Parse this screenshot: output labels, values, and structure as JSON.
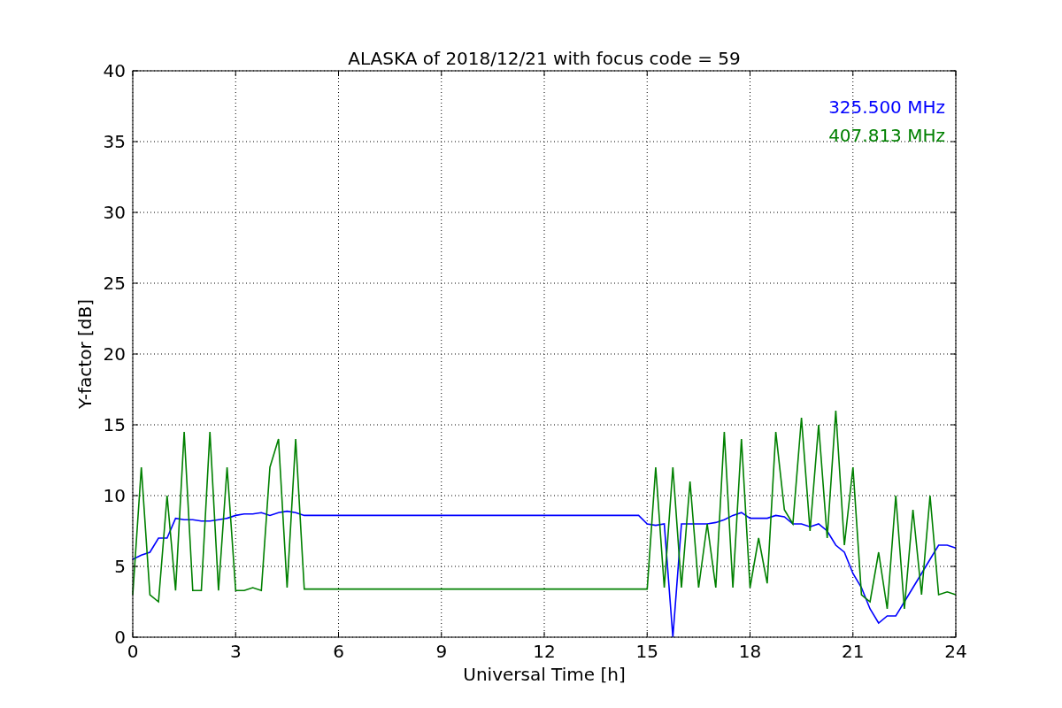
{
  "chart_data": {
    "type": "line",
    "title": "ALASKA of 2018/12/21 with focus code = 59",
    "xlabel": "Universal Time [h]",
    "ylabel": "Y-factor [dB]",
    "x": [
      0,
      0.25,
      0.5,
      0.75,
      1,
      1.25,
      1.5,
      1.75,
      2,
      2.25,
      2.5,
      2.75,
      3,
      3.25,
      3.5,
      3.75,
      4,
      4.25,
      4.5,
      4.75,
      5,
      5.25,
      5.5,
      5.75,
      6,
      6.25,
      6.5,
      6.75,
      7,
      7.25,
      7.5,
      7.75,
      8,
      8.25,
      8.5,
      8.75,
      9,
      9.25,
      9.5,
      9.75,
      10,
      10.25,
      10.5,
      10.75,
      11,
      11.25,
      11.5,
      11.75,
      12,
      12.25,
      12.5,
      12.75,
      13,
      13.25,
      13.5,
      13.75,
      14,
      14.25,
      14.5,
      14.75,
      15,
      15.25,
      15.5,
      15.75,
      16,
      16.25,
      16.5,
      16.75,
      17,
      17.25,
      17.5,
      17.75,
      18,
      18.25,
      18.5,
      18.75,
      19,
      19.25,
      19.5,
      19.75,
      20,
      20.25,
      20.5,
      20.75,
      21,
      21.25,
      21.5,
      21.75,
      22,
      22.25,
      22.5,
      22.75,
      23,
      23.25,
      23.5,
      23.75,
      24
    ],
    "series": [
      {
        "name": "325.500 MHz",
        "color": "#0000ff",
        "values": [
          5.5,
          5.8,
          6,
          7,
          7,
          8.4,
          8.3,
          8.3,
          8.2,
          8.2,
          8.3,
          8.4,
          8.6,
          8.7,
          8.7,
          8.8,
          8.6,
          8.8,
          8.9,
          8.8,
          8.6,
          8.6,
          8.6,
          8.6,
          8.6,
          8.6,
          8.6,
          8.6,
          8.6,
          8.6,
          8.6,
          8.6,
          8.6,
          8.6,
          8.6,
          8.6,
          8.6,
          8.6,
          8.6,
          8.6,
          8.6,
          8.6,
          8.6,
          8.6,
          8.6,
          8.6,
          8.6,
          8.6,
          8.6,
          8.6,
          8.6,
          8.6,
          8.6,
          8.6,
          8.6,
          8.6,
          8.6,
          8.6,
          8.6,
          8.6,
          8.0,
          7.9,
          8.0,
          0,
          8.0,
          8.0,
          8.0,
          8.0,
          8.1,
          8.3,
          8.6,
          8.8,
          8.4,
          8.4,
          8.4,
          8.6,
          8.5,
          8.0,
          8.0,
          7.8,
          8.0,
          7.5,
          6.5,
          6,
          4.5,
          3.5,
          2,
          1,
          1.5,
          1.5,
          2.5,
          3.5,
          4.5,
          5.5,
          6.5,
          6.5,
          6.3
        ]
      },
      {
        "name": "407.813 MHz",
        "color": "#008000",
        "values": [
          3,
          12,
          3,
          2.5,
          10,
          3.3,
          14.5,
          3.3,
          3.3,
          14.5,
          3.3,
          12,
          3.3,
          3.3,
          3.5,
          3.3,
          12,
          14,
          3.5,
          14,
          3.4,
          3.4,
          3.4,
          3.4,
          3.4,
          3.4,
          3.4,
          3.4,
          3.4,
          3.4,
          3.4,
          3.4,
          3.4,
          3.4,
          3.4,
          3.4,
          3.4,
          3.4,
          3.4,
          3.4,
          3.4,
          3.4,
          3.4,
          3.4,
          3.4,
          3.4,
          3.4,
          3.4,
          3.4,
          3.4,
          3.4,
          3.4,
          3.4,
          3.4,
          3.4,
          3.4,
          3.4,
          3.4,
          3.4,
          3.4,
          3.4,
          12,
          3.5,
          12,
          3.5,
          11,
          3.5,
          8,
          3.5,
          14.5,
          3.5,
          14,
          3.5,
          7,
          3.8,
          14.5,
          9,
          8,
          15.5,
          7.5,
          15,
          7,
          16,
          6.5,
          12,
          3,
          2.5,
          6,
          2,
          10,
          2,
          9,
          3,
          10,
          3,
          3.2,
          3
        ]
      }
    ],
    "xlim": [
      0,
      24
    ],
    "ylim": [
      0,
      40
    ],
    "xticks": [
      0,
      3,
      6,
      9,
      12,
      15,
      18,
      21,
      24
    ],
    "yticks": [
      0,
      5,
      10,
      15,
      20,
      25,
      30,
      35,
      40
    ],
    "grid": true
  }
}
